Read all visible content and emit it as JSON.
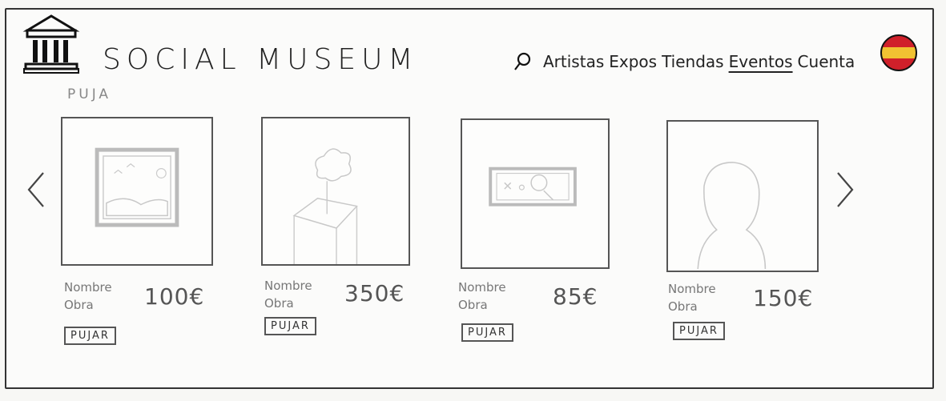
{
  "header": {
    "title": "SOCIAL MUSEUM",
    "nav": [
      {
        "label": "Artistas",
        "active": false
      },
      {
        "label": "Expos",
        "active": false
      },
      {
        "label": "Tiendas",
        "active": false
      },
      {
        "label": "Eventos",
        "active": true
      },
      {
        "label": "Cuenta",
        "active": false
      }
    ],
    "language_flag": "spain-flag-icon"
  },
  "section": {
    "label": "PUJA"
  },
  "carousel": {
    "items": [
      {
        "name": "Nombre Obra",
        "price": "100€",
        "button": "PUJAR",
        "artwork": "framed-landscape-painting"
      },
      {
        "name": "Nombre Obra",
        "price": "350€",
        "button": "PUJAR",
        "artwork": "sculpture-on-pedestal"
      },
      {
        "name": "Nombre Obra",
        "price": "85€",
        "button": "PUJAR",
        "artwork": "framed-abstract-artwork"
      },
      {
        "name": "Nombre Obra",
        "price": "150€",
        "button": "PUJAR",
        "artwork": "bust-silhouette"
      }
    ],
    "prev_icon": "chevron-left-icon",
    "next_icon": "chevron-right-icon"
  },
  "colors": {
    "ink": "#222222",
    "flag_red": "#d0202a",
    "flag_yellow": "#f1c232"
  }
}
